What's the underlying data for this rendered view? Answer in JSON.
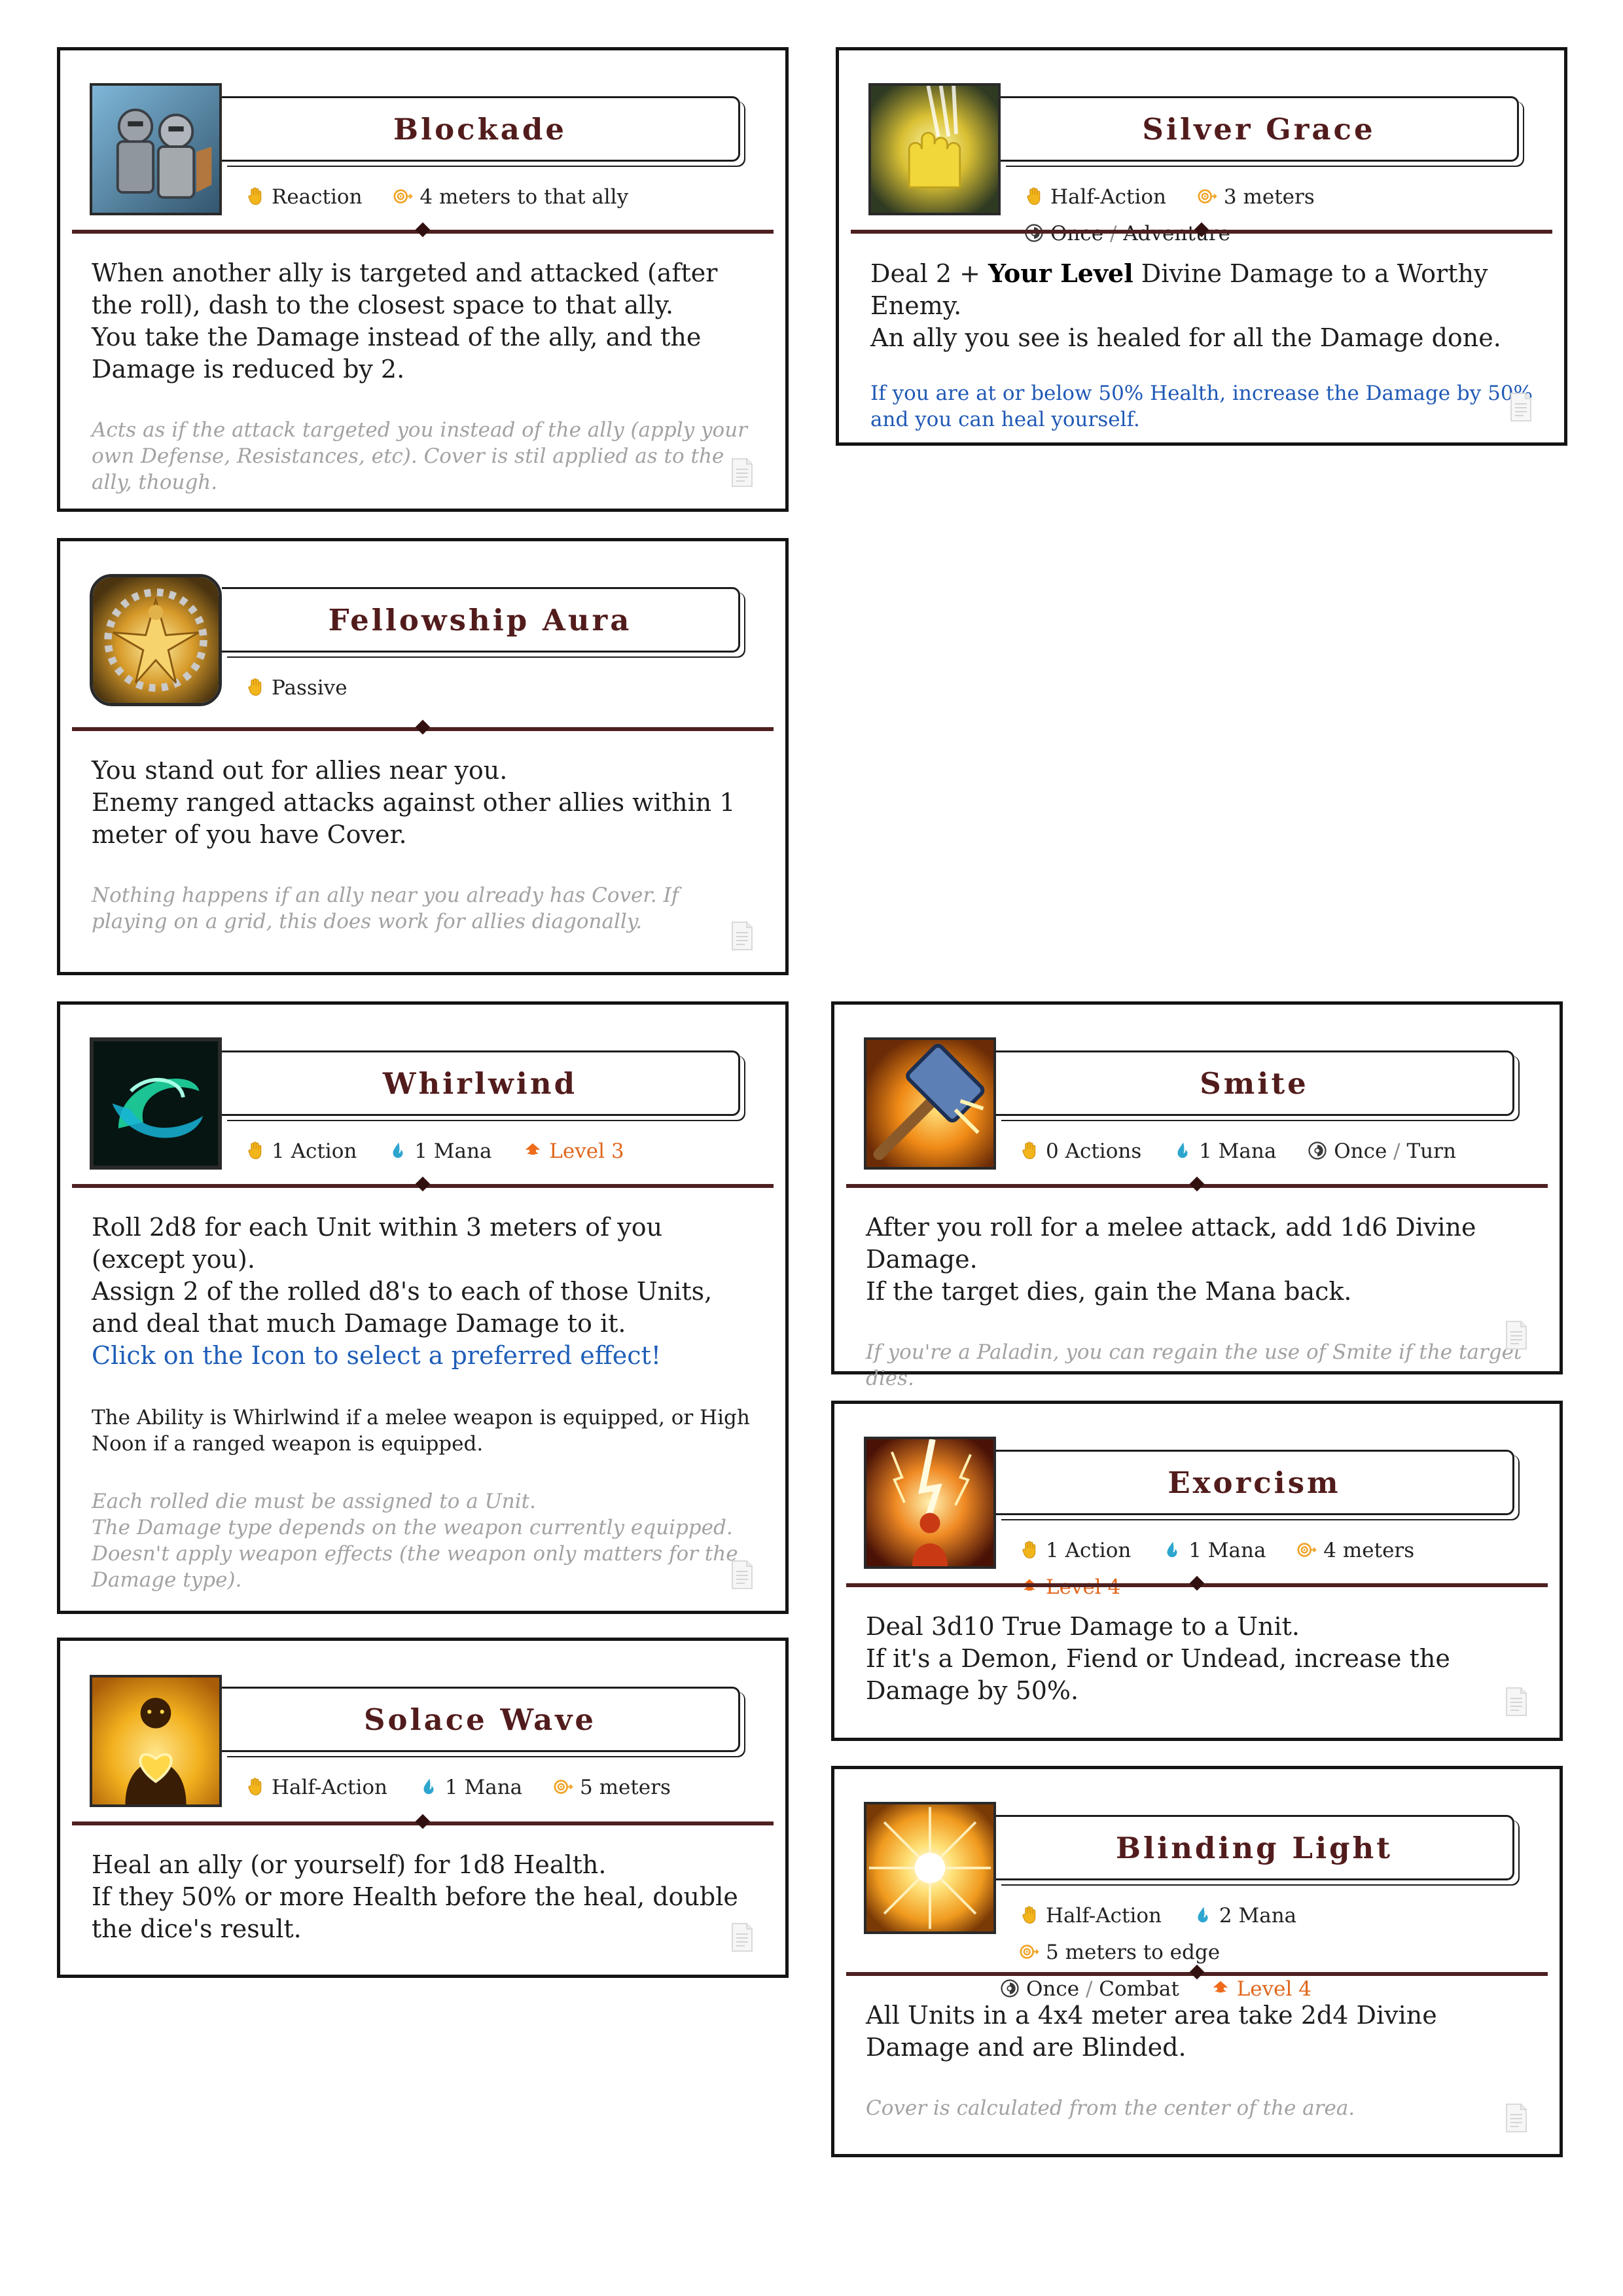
{
  "icon_names": {
    "action": "hand-icon",
    "range": "range-target-icon",
    "mana": "mana-drop-icon",
    "usage": "usage-limit-icon",
    "level": "level-up-icon",
    "notes": "document-icon"
  },
  "colors": {
    "title": "#521c1c",
    "divider": "#4e2020",
    "level": "#e0661b",
    "link_blue": "#1f5eb8",
    "note_grey": "#a2a2a2"
  },
  "cards": {
    "blockade": {
      "title": "Blockade",
      "action": "Reaction",
      "range": "4 meters to that ally",
      "body": [
        "When another ally is targeted and attacked (after the roll), dash to the closest space to that ally.",
        "You take the Damage instead of the ally, and the Damage is reduced by 2."
      ],
      "note": "Acts as if the attack targeted you instead of the ally (apply your own Defense, Resistances, etc). Cover is stil applied as to the ally, though."
    },
    "silver_grace": {
      "title": "Silver Grace",
      "action": "Half-Action",
      "range": "3 meters",
      "usage_a": "Once",
      "usage_sep": "/",
      "usage_b": "Adventure",
      "body_pre": "Deal 2 + ",
      "body_bold": "Your Level",
      "body_post": " Divine Damage to a Worthy Enemy.",
      "body_line2": "An ally you see is healed for all the Damage done.",
      "extra": "If you are at or below 50% Health, increase the Damage by 50% and you can heal yourself."
    },
    "fellowship_aura": {
      "title": "Fellowship Aura",
      "action": "Passive",
      "body": [
        "You stand out for allies near you.",
        "Enemy ranged attacks against other allies within 1 meter of you have Cover."
      ],
      "note": "Nothing happens if an ally near you already has Cover. If playing on a grid, this does work for allies diagonally."
    },
    "whirlwind": {
      "title": "Whirlwind",
      "action": "1 Action",
      "mana": "1 Mana",
      "level": "Level 3",
      "body": [
        "Roll 2d8 for each Unit within 3 meters of you (except you).",
        "Assign 2 of the rolled d8's to each of those Units, and deal that much Damage Damage to it."
      ],
      "link": "Click on the Icon to select a preferred effect!",
      "extra": "The Ability is Whirlwind if a melee weapon is equipped, or High Noon if a ranged weapon is equipped.",
      "note_lines": [
        "Each rolled die must be assigned to a Unit.",
        "The Damage type depends on the weapon currently equipped. Doesn't apply weapon effects (the weapon only matters for the Damage type)."
      ]
    },
    "smite": {
      "title": "Smite",
      "action": "0 Actions",
      "mana": "1 Mana",
      "usage_a": "Once",
      "usage_sep": "/",
      "usage_b": "Turn",
      "body": [
        "After you roll for a melee attack, add 1d6 Divine Damage.",
        "If the target dies, gain the Mana back."
      ],
      "note": "If you're a Paladin, you can regain the use of Smite if the target dies."
    },
    "exorcism": {
      "title": "Exorcism",
      "action": "1 Action",
      "mana": "1 Mana",
      "range": "4 meters",
      "level": "Level 4",
      "body": [
        "Deal 3d10 True Damage to a Unit.",
        "If it's a Demon, Fiend or Undead, increase the Damage by 50%."
      ]
    },
    "solace_wave": {
      "title": "Solace Wave",
      "action": "Half-Action",
      "mana": "1 Mana",
      "range": "5 meters",
      "body": [
        "Heal an ally (or yourself) for 1d8 Health.",
        "If they 50% or more Health before the heal, double the dice's result."
      ]
    },
    "blinding_light": {
      "title": "Blinding Light",
      "action": "Half-Action",
      "mana": "2 Mana",
      "range": "5 meters to edge",
      "usage_a": "Once",
      "usage_sep": "/",
      "usage_b": "Combat",
      "level": "Level 4",
      "body": [
        "All Units in a 4x4 meter area take 2d4 Divine Damage and are Blinded."
      ],
      "note": "Cover is calculated from the center of the area."
    }
  }
}
